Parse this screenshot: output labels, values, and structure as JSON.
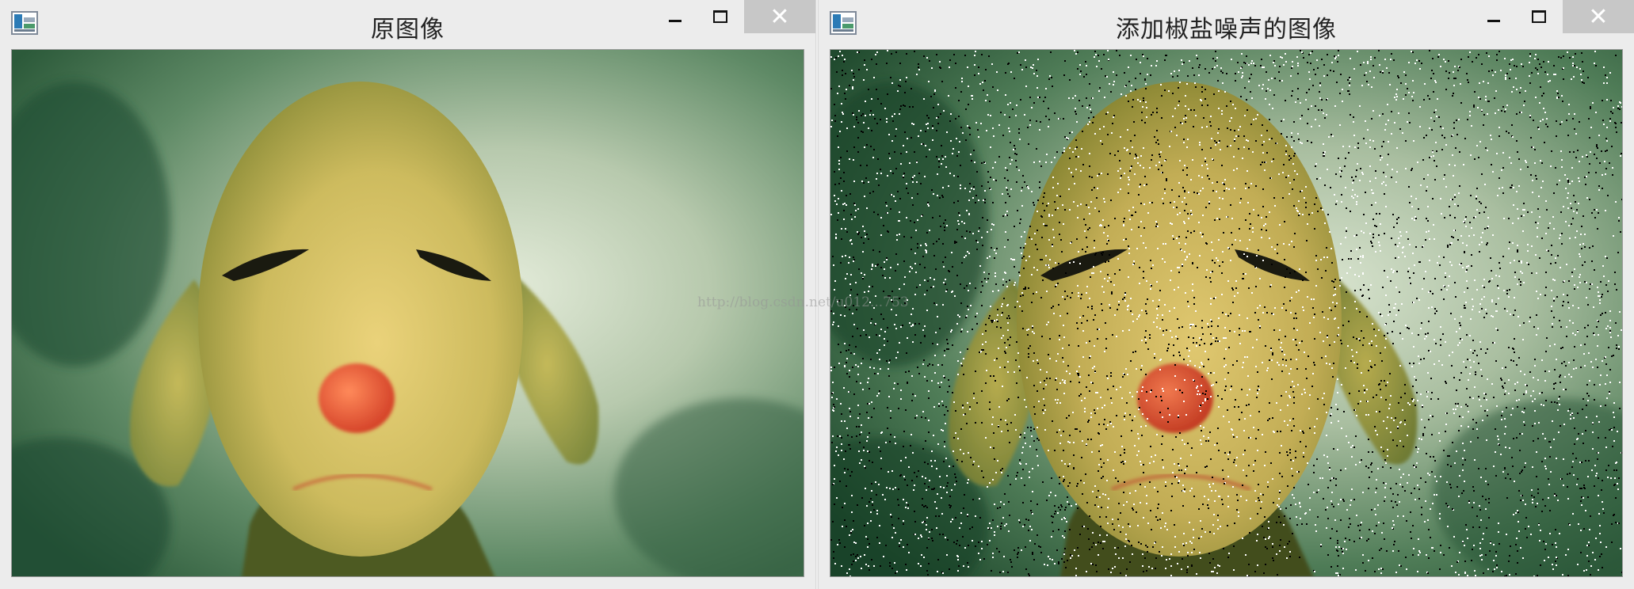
{
  "windows": [
    {
      "title": "原图像",
      "controls": {
        "minimize": "",
        "maximize": "",
        "close": "✕"
      }
    },
    {
      "title": "添加椒盐噪声的图像",
      "controls": {
        "minimize": "",
        "maximize": "",
        "close": "✕"
      }
    }
  ],
  "watermark": "http://blog.csdn.net/u012...753",
  "colors": {
    "titlebar": "#ececec",
    "close_button": "#c7c7c7",
    "figure_yellow": "#d2c46a",
    "nose": "#e8603a",
    "background_green": "#3f6e4b"
  },
  "icons": {
    "app": "opencv-window-icon",
    "minimize": "minimize-icon",
    "maximize": "maximize-icon",
    "close": "close-icon"
  }
}
